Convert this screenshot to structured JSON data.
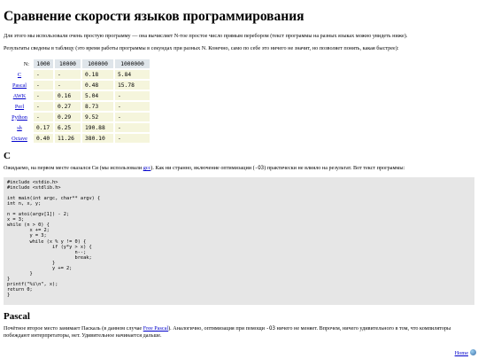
{
  "title": "Сравнение скорости языков программирования",
  "intro": {
    "p1": "Для этого мы использовали очень простую программу — она вычисляет N-тое простое число прямым перебором (текст программы на разных языках можно увидеть ниже).",
    "p2": "Результаты сведены в таблицу (это время работы программы в секундах при разных N. Конечно, само по себе это ничего не значит, но позволяет понять, какая быстрее):"
  },
  "table": {
    "n_label": "N:",
    "columns": [
      "1000",
      "10000",
      "100000",
      "1000000"
    ],
    "rows": [
      {
        "lang": "C",
        "values": [
          "-",
          "-",
          "0.18",
          "5.84"
        ]
      },
      {
        "lang": "Pascal",
        "values": [
          "-",
          "-",
          "0.48",
          "15.78"
        ]
      },
      {
        "lang": "AWK",
        "values": [
          "-",
          "0.16",
          "5.04",
          "-"
        ]
      },
      {
        "lang": "Perl",
        "values": [
          "-",
          "0.27",
          "8.73",
          "-"
        ]
      },
      {
        "lang": "Python",
        "values": [
          "-",
          "0.29",
          "9.52",
          "-"
        ]
      },
      {
        "lang": "sh",
        "values": [
          "0.17",
          "6.25",
          "190.88",
          "-"
        ]
      },
      {
        "lang": "Octave",
        "values": [
          "0.40",
          "11.26",
          "380.10",
          "-"
        ]
      }
    ]
  },
  "c_section": {
    "heading": "C",
    "text_before": "Ожидаемо, на первом месте оказался Си (мы использовали ",
    "link": "gcc",
    "text_mid": "). Как ни странно, включение оптимизации (",
    "code_flag": "-O3",
    "text_after": ") практически не влияло на результат. Вот текст программы:",
    "code": "#include <stdio.h>\n#include <stdlib.h>\n\nint main(int argc, char** argv) {\nint n, x, y;\n\nn = atoi(argv[1]) - 2;\nx = 3;\nwhile (n > 0) {\n        x += 2;\n        y = 3;\n        while (x % y != 0) {\n                if (y*y > x) {\n                        n--;\n                        break;\n                }\n                y += 2;\n        }\n}\nprintf(\"%i\\n\", x);\nreturn 0;\n}"
  },
  "pascal_section": {
    "heading": "Pascal",
    "text_before": "Почётное второе место занимает Паскаль (в данном случае ",
    "link": "Free Pascal",
    "text_mid": "). Аналогично, оптимизация при помощи ",
    "code_flag": "-O3",
    "text_after": " ничего не меняет. Впрочем, ничего удивительного в том, что компиляторы побеждают интерпретаторы, нет. Удивительное начинается дальше."
  },
  "footer": {
    "home": "Home",
    "icon": "globe-icon"
  }
}
